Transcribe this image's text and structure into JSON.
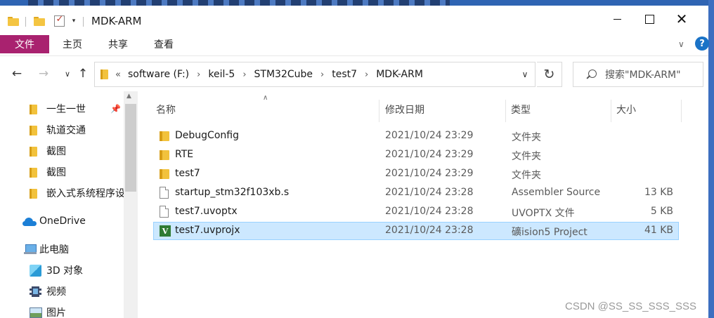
{
  "window": {
    "title": "MDK-ARM"
  },
  "ribbon": {
    "tabs": [
      {
        "label": "文件"
      },
      {
        "label": "主页"
      },
      {
        "label": "共享"
      },
      {
        "label": "查看"
      }
    ],
    "help_label": "?"
  },
  "address": {
    "overflow": "«",
    "crumbs": [
      "software (F:)",
      "keil-5",
      "STM32Cube",
      "test7",
      "MDK-ARM"
    ]
  },
  "search": {
    "placeholder": "搜索\"MDK-ARM\""
  },
  "sidebar": {
    "items": [
      {
        "label": "一生一世",
        "icon": "folder-icon",
        "pinned": true
      },
      {
        "label": "轨道交通",
        "icon": "folder-icon"
      },
      {
        "label": "截图",
        "icon": "folder-icon"
      },
      {
        "label": "截图",
        "icon": "folder-icon"
      },
      {
        "label": "嵌入式系统程序设",
        "icon": "folder-icon"
      },
      {
        "label": "OneDrive",
        "icon": "onedrive-icon"
      },
      {
        "label": "此电脑",
        "icon": "this-pc-icon"
      },
      {
        "label": "3D 对象",
        "icon": "3d-objects-icon"
      },
      {
        "label": "视频",
        "icon": "videos-icon"
      },
      {
        "label": "图片",
        "icon": "pictures-icon"
      }
    ]
  },
  "columns": {
    "name": "名称",
    "date": "修改日期",
    "type": "类型",
    "size": "大小"
  },
  "files": [
    {
      "name": "DebugConfig",
      "date": "2021/10/24 23:29",
      "type": "文件夹",
      "size": "",
      "icon": "folder-icon"
    },
    {
      "name": "RTE",
      "date": "2021/10/24 23:29",
      "type": "文件夹",
      "size": "",
      "icon": "folder-icon"
    },
    {
      "name": "test7",
      "date": "2021/10/24 23:29",
      "type": "文件夹",
      "size": "",
      "icon": "folder-icon"
    },
    {
      "name": "startup_stm32f103xb.s",
      "date": "2021/10/24 23:28",
      "type": "Assembler Source",
      "size": "13 KB",
      "icon": "file-icon"
    },
    {
      "name": "test7.uvoptx",
      "date": "2021/10/24 23:28",
      "type": "UVOPTX 文件",
      "size": "5 KB",
      "icon": "file-icon"
    },
    {
      "name": "test7.uvprojx",
      "date": "2021/10/24 23:28",
      "type": "礦ision5 Project",
      "size": "41 KB",
      "icon": "uvision-icon",
      "selected": true
    }
  ],
  "watermark": "CSDN @SS_SS_SSS_SSS",
  "colors": {
    "file_tab": "#a9226f",
    "selection": "#cce8ff",
    "selection_border": "#99d1ff",
    "folder": "#f2c23c"
  }
}
